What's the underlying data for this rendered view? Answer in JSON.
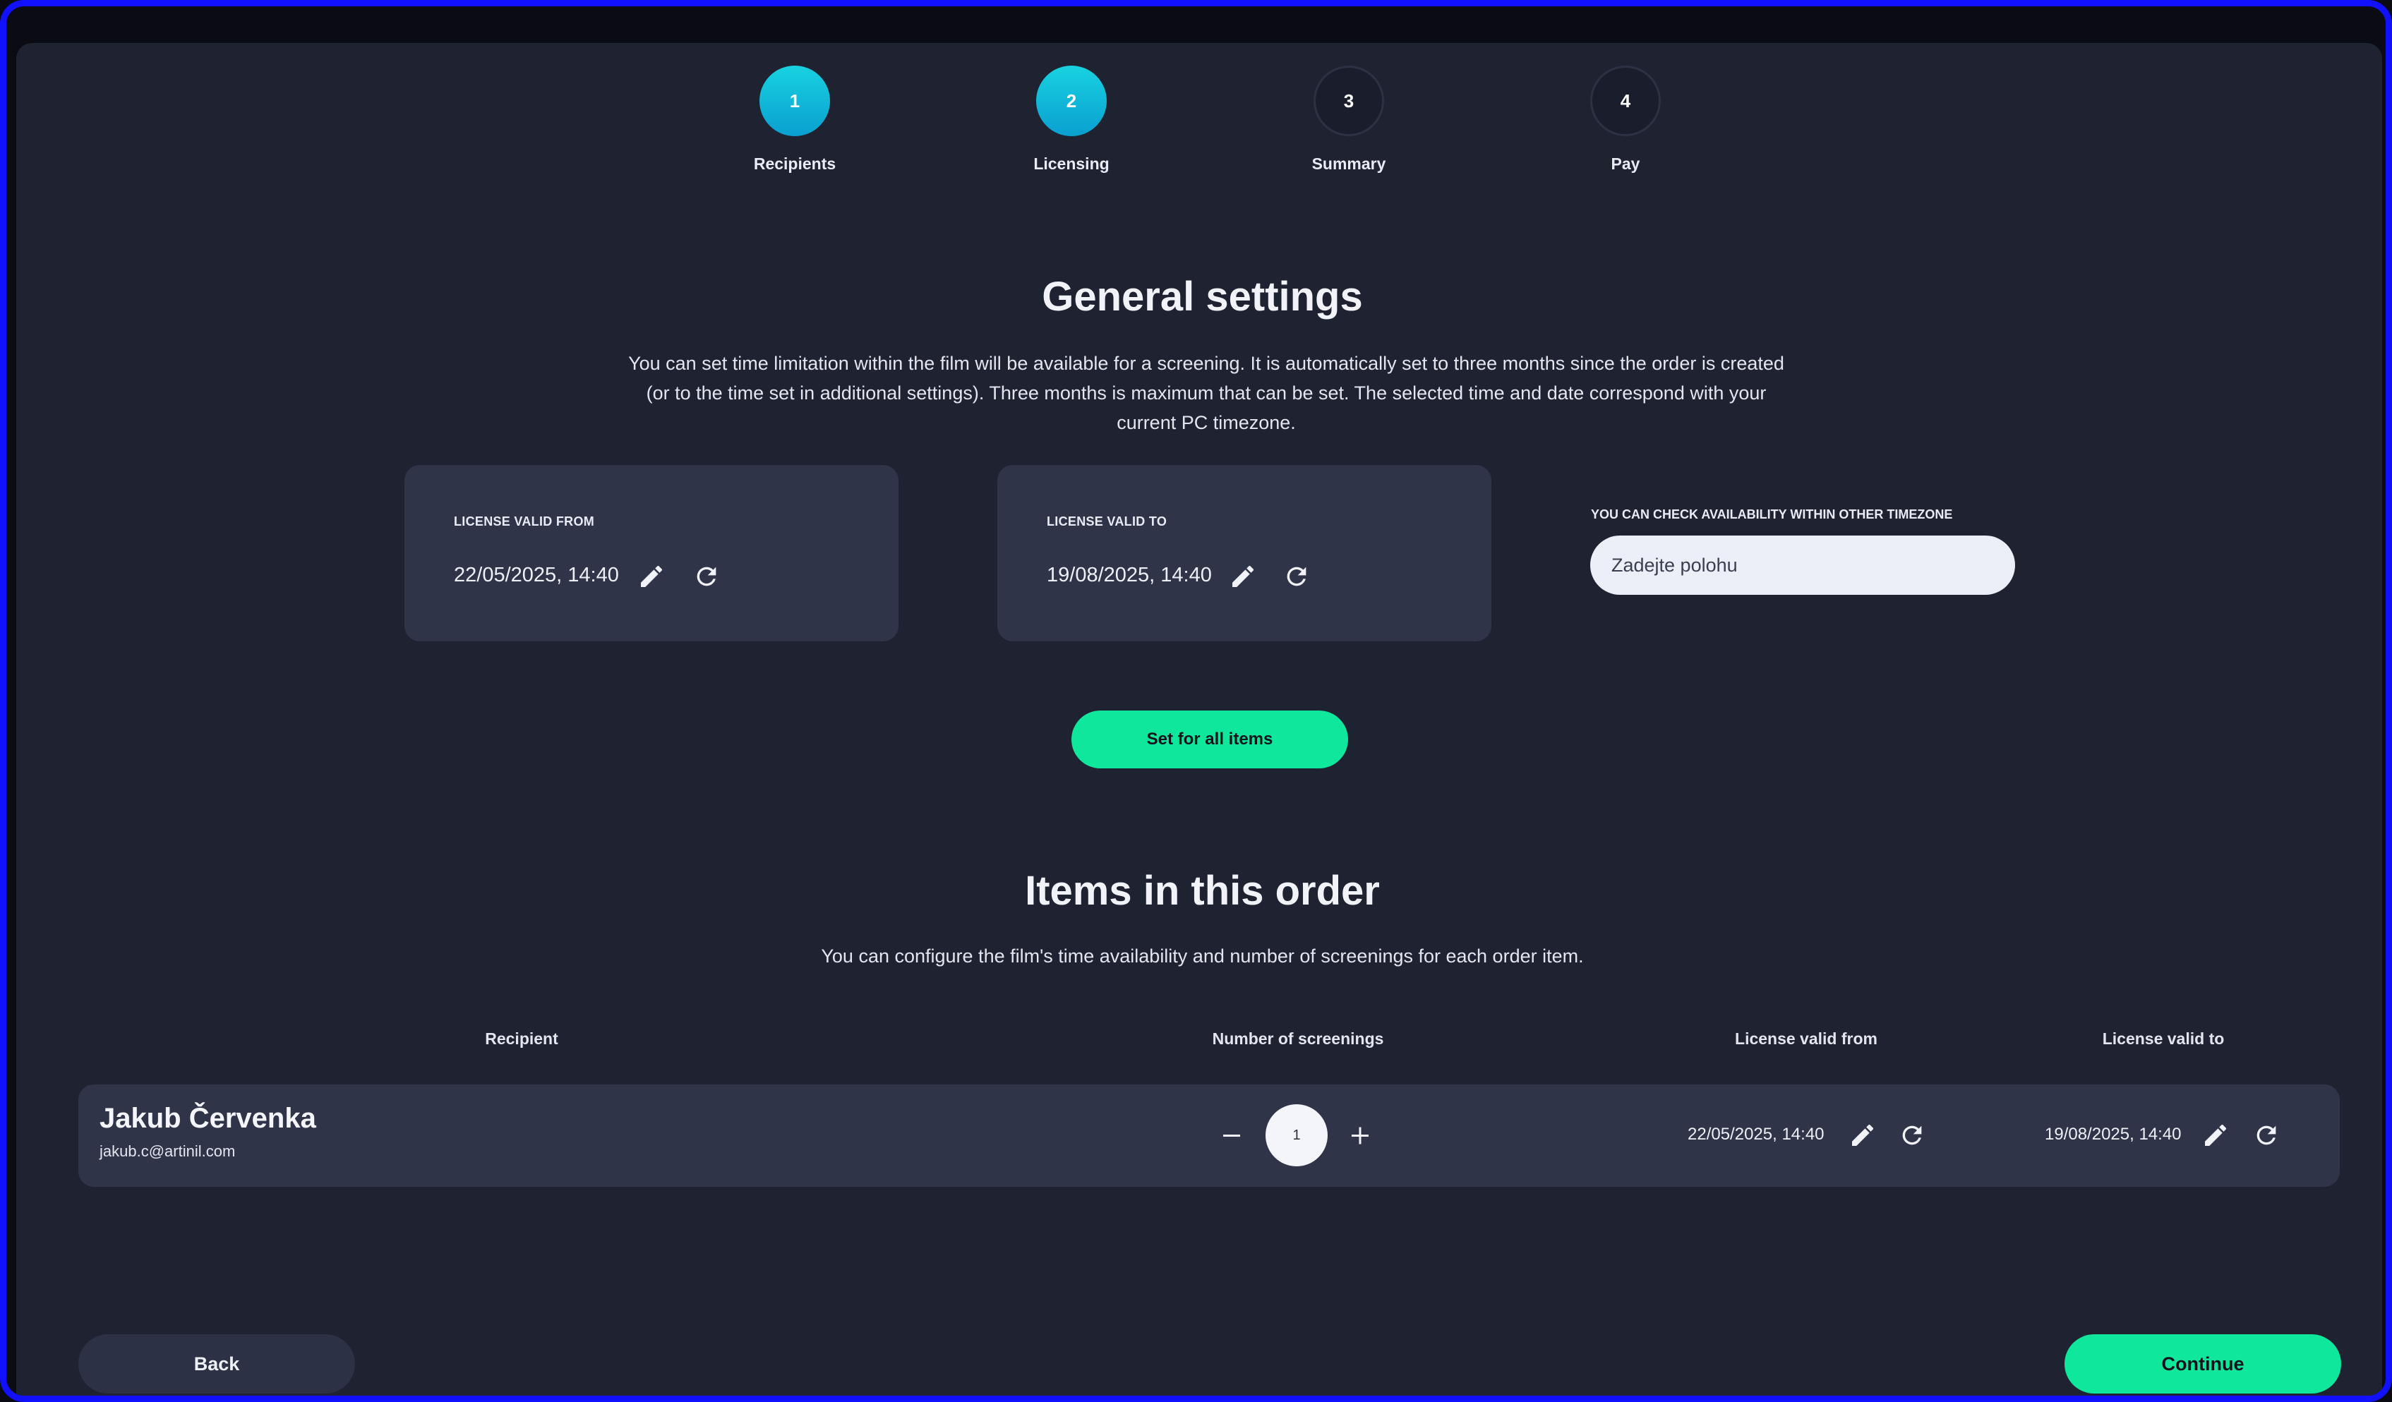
{
  "steps": [
    {
      "number": "1",
      "label": "Recipients"
    },
    {
      "number": "2",
      "label": "Licensing"
    },
    {
      "number": "3",
      "label": "Summary"
    },
    {
      "number": "4",
      "label": "Pay"
    }
  ],
  "general": {
    "title": "General settings",
    "description_lines": [
      "You can set time limitation within the film will be available for a screening. It is automatically set to three months since the order is created",
      "(or to the time set in additional settings). Three months is maximum that can be set. The selected time and date correspond with your",
      "current PC timezone."
    ],
    "valid_from": {
      "caption": "LICENSE VALID FROM",
      "value": "22/05/2025, 14:40"
    },
    "valid_to": {
      "caption": "LICENSE VALID TO",
      "value": "19/08/2025, 14:40"
    },
    "timezone": {
      "caption": "YOU CAN CHECK AVAILABILITY WITHIN OTHER TIMEZONE",
      "placeholder": "Zadejte polohu"
    },
    "set_all_button": "Set for all items"
  },
  "items": {
    "title": "Items in this order",
    "description": "You can configure the film's time availability and number of screenings for each order item.",
    "columns": [
      "Recipient",
      "Number of screenings",
      "License valid from",
      "License valid to"
    ],
    "rows": [
      {
        "name": "Jakub Červenka",
        "email": "jakub.c@artinil.com",
        "screenings": "1",
        "valid_from": "22/05/2025, 14:40",
        "valid_to": "19/08/2025, 14:40"
      }
    ]
  },
  "footer": {
    "back": "Back",
    "continue": "Continue"
  },
  "colors": {
    "accent": "#0ee79c",
    "step_active": "#18d2e0",
    "card": "#2f3449",
    "background": "#1e2231"
  }
}
